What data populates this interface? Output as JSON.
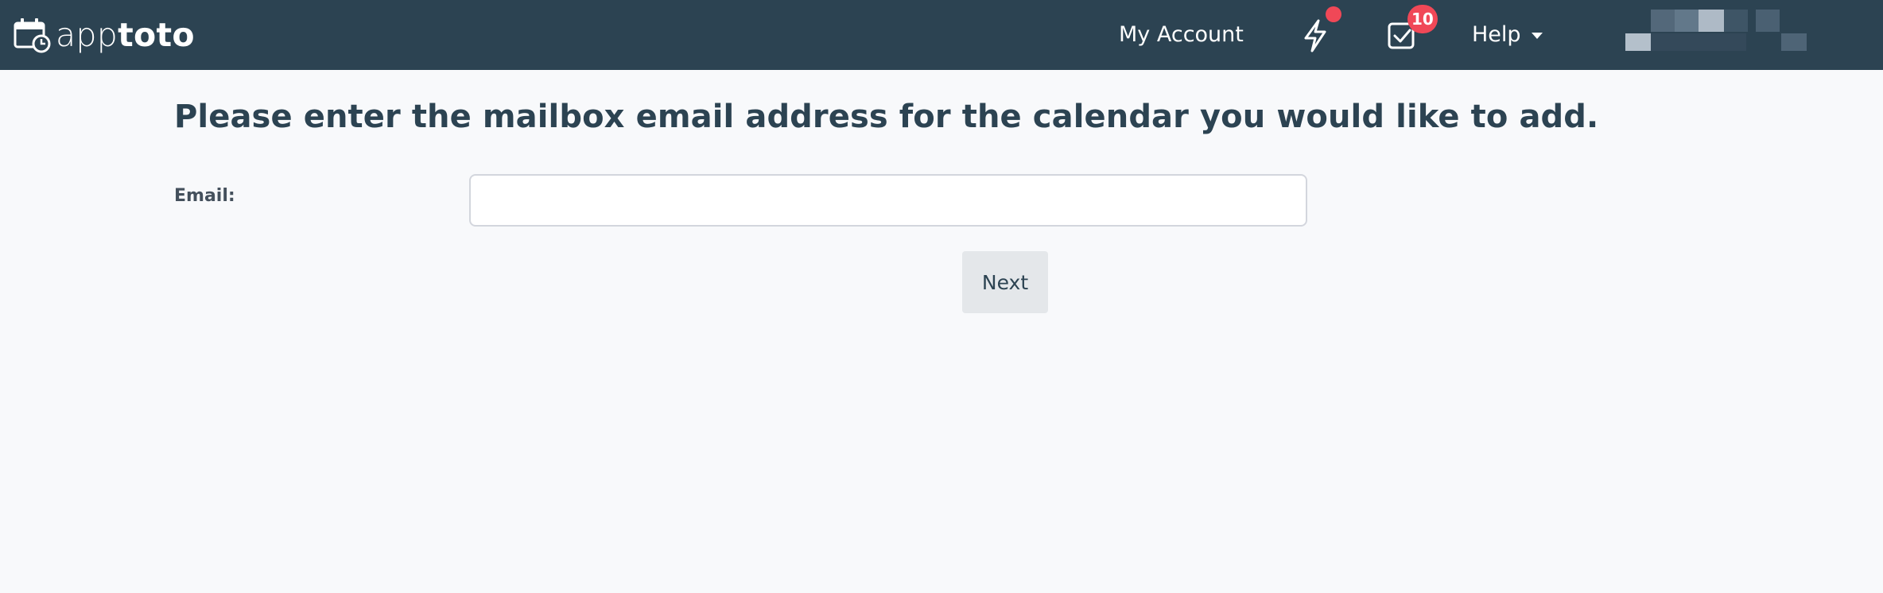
{
  "brand": {
    "name_light": "app",
    "name_bold": "toto"
  },
  "nav": {
    "account_label": "My Account",
    "notifications_dot_color": "#f04857",
    "tasks_count": "10",
    "help_label": "Help",
    "user_name_blurred": true
  },
  "main": {
    "heading": "Please enter the mailbox email address for the calendar you would like to add.",
    "email_label": "Email:",
    "email_value": "",
    "email_placeholder": "",
    "next_label": "Next"
  },
  "colors": {
    "navbar_bg": "#2c4352",
    "page_bg": "#f8f9fb",
    "badge_red": "#f04857",
    "heading_text": "#2c4352"
  }
}
